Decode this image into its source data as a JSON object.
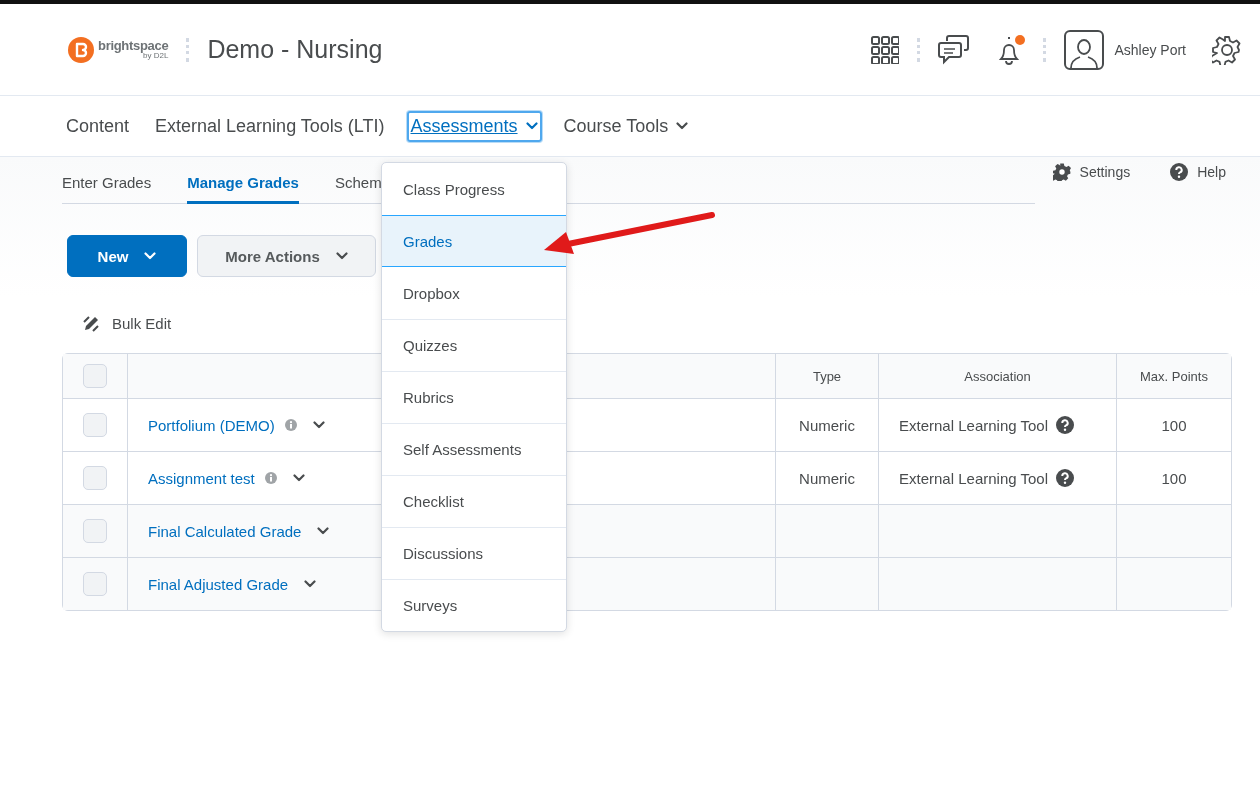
{
  "header": {
    "logo": {
      "name": "brightspace",
      "byline": "by D2L"
    },
    "course_title": "Demo - Nursing",
    "user_name": "Ashley Port",
    "notification_unread": true
  },
  "nav": [
    {
      "label": "Content",
      "selected": false,
      "menu": false
    },
    {
      "label": "External Learning Tools (LTI)",
      "selected": false,
      "menu": false
    },
    {
      "label": "Assessments",
      "selected": true,
      "menu": true
    },
    {
      "label": "Course Tools",
      "selected": false,
      "menu": true
    }
  ],
  "dropdown": [
    {
      "label": "Class Progress",
      "selected": false
    },
    {
      "label": "Grades",
      "selected": true
    },
    {
      "label": "Dropbox",
      "selected": false
    },
    {
      "label": "Quizzes",
      "selected": false
    },
    {
      "label": "Rubrics",
      "selected": false
    },
    {
      "label": "Self Assessments",
      "selected": false
    },
    {
      "label": "Checklist",
      "selected": false
    },
    {
      "label": "Discussions",
      "selected": false
    },
    {
      "label": "Surveys",
      "selected": false
    }
  ],
  "tabs": [
    {
      "label": "Enter Grades",
      "selected": false
    },
    {
      "label": "Manage Grades",
      "selected": true
    },
    {
      "label": "Schem",
      "selected": false
    }
  ],
  "tools": [
    {
      "kind": "settings",
      "label": "Settings"
    },
    {
      "kind": "help",
      "label": "Help"
    }
  ],
  "buttons": [
    {
      "label": "New",
      "kind": "primary"
    },
    {
      "label": "More Actions",
      "kind": "secondary"
    }
  ],
  "bulk_edit": "Bulk Edit",
  "table": {
    "select_all_checked": false,
    "columns": [
      "Type",
      "Association",
      "Max. Points"
    ],
    "rows": [
      {
        "kind": "item",
        "name": "Portfolium (DEMO)",
        "info": true,
        "checked": false,
        "type": "Numeric",
        "association": "External Learning Tool",
        "help": true,
        "max_points": "100"
      },
      {
        "kind": "item",
        "name": "Assignment test",
        "info": true,
        "checked": false,
        "type": "Numeric",
        "association": "External Learning Tool",
        "help": true,
        "max_points": "100"
      },
      {
        "kind": "final",
        "name": "Final Calculated Grade",
        "info": false,
        "checked": false
      },
      {
        "kind": "final",
        "name": "Final Adjusted Grade",
        "info": false,
        "checked": false
      }
    ]
  }
}
